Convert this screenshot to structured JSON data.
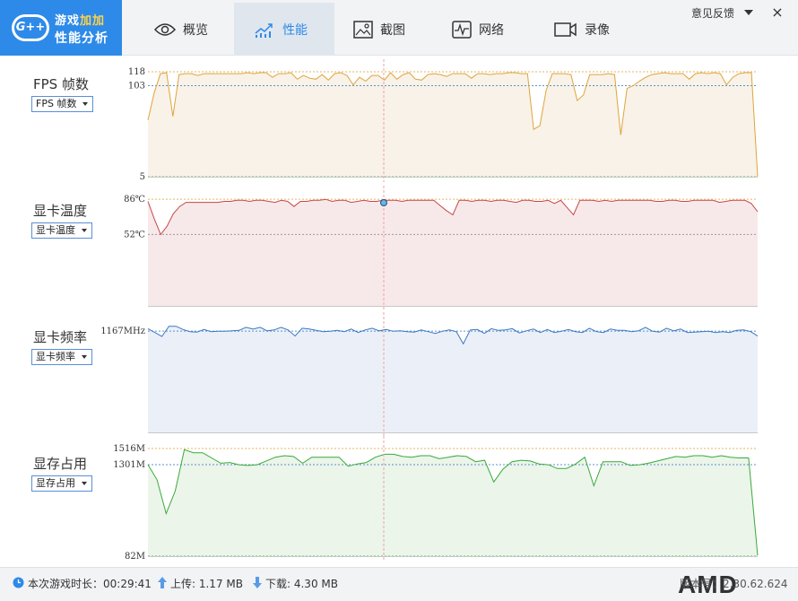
{
  "app": {
    "title_line1_part1": "游戏",
    "title_line1_part2": "加加",
    "title_line2": "性能分析",
    "badge_text": "G++"
  },
  "tabs": [
    {
      "label": "概览",
      "icon": "eye-icon"
    },
    {
      "label": "性能",
      "icon": "line-chart-icon",
      "active": true
    },
    {
      "label": "截图",
      "icon": "image-icon"
    },
    {
      "label": "网络",
      "icon": "pulse-icon"
    },
    {
      "label": "录像",
      "icon": "video-icon"
    }
  ],
  "header": {
    "feedback_label": "意见反馈",
    "close_label": "×"
  },
  "colors": {
    "accent": "#2e8ae8",
    "fps": "#e0a43a",
    "gpu_temp": "#c84646",
    "gpu_clock": "#3a78c0",
    "vram": "#3aa93a"
  },
  "chart_data": [
    {
      "type": "area",
      "title": "FPS 帧数",
      "dropdown": "FPS 帧数",
      "ticks": [
        "118",
        "103",
        "5"
      ],
      "tick_values": [
        118,
        103,
        5
      ],
      "ylim": [
        5,
        118
      ],
      "average": 103,
      "values": [
        66,
        95,
        116,
        117,
        70,
        115,
        116,
        116,
        114,
        116,
        116,
        116,
        116,
        116,
        116,
        116,
        117,
        116,
        117,
        117,
        112,
        116,
        116,
        117,
        110,
        114,
        111,
        110,
        115,
        109,
        116,
        117,
        114,
        104,
        112,
        108,
        114,
        114,
        109,
        117,
        110,
        115,
        117,
        110,
        109,
        115,
        116,
        115,
        113,
        116,
        116,
        116,
        111,
        116,
        116,
        115,
        116,
        116,
        117,
        117,
        116,
        116,
        56,
        60,
        98,
        116,
        116,
        116,
        115,
        87,
        93,
        115,
        115,
        115,
        116,
        115,
        50,
        100,
        103,
        108,
        112,
        115,
        116,
        117,
        116,
        116,
        116,
        110,
        116,
        117,
        116,
        117,
        116,
        104,
        112,
        116,
        117,
        117,
        5
      ]
    },
    {
      "type": "area",
      "title": "显卡温度",
      "dropdown": "显卡温度",
      "ticks": [
        "86℃",
        "52℃"
      ],
      "tick_values": [
        86,
        52
      ],
      "ylim": [
        -17,
        87
      ],
      "values": [
        84,
        67,
        52,
        60,
        72,
        79,
        83,
        83,
        83,
        83,
        83,
        83,
        84,
        84,
        85,
        85,
        84,
        85,
        85,
        84,
        83,
        85,
        84,
        79,
        84,
        84,
        85,
        85,
        86,
        84,
        85,
        85,
        83,
        84,
        85,
        84,
        84,
        85,
        85,
        85,
        84,
        85,
        85,
        85,
        85,
        85,
        80,
        75,
        71,
        85,
        85,
        84,
        85,
        85,
        84,
        85,
        85,
        84,
        83,
        85,
        85,
        84,
        84,
        85,
        82,
        85,
        78,
        71,
        85,
        85,
        85,
        84,
        85,
        84,
        85,
        85,
        85,
        85,
        85,
        85,
        84,
        84,
        85,
        85,
        84,
        84,
        85,
        85,
        85,
        85,
        83,
        84,
        85,
        85,
        85,
        82,
        74
      ]
    },
    {
      "type": "area",
      "title": "显卡频率",
      "dropdown": "显卡频率",
      "ticks": [
        "1167MHz"
      ],
      "tick_values": [
        1167
      ],
      "ylim": [
        0,
        1240
      ],
      "values": [
        1195,
        1150,
        1105,
        1222,
        1222,
        1185,
        1160,
        1155,
        1185,
        1160,
        1165,
        1165,
        1170,
        1175,
        1210,
        1190,
        1210,
        1170,
        1180,
        1210,
        1180,
        1110,
        1200,
        1190,
        1175,
        1160,
        1165,
        1175,
        1160,
        1190,
        1150,
        1180,
        1200,
        1170,
        1185,
        1165,
        1170,
        1160,
        1155,
        1180,
        1160,
        1140,
        1165,
        1180,
        1160,
        1020,
        1180,
        1185,
        1140,
        1195,
        1175,
        1180,
        1195,
        1145,
        1170,
        1190,
        1150,
        1185,
        1150,
        1165,
        1185,
        1160,
        1150,
        1200,
        1160,
        1150,
        1190,
        1175,
        1175,
        1160,
        1170,
        1210,
        1165,
        1155,
        1200,
        1170,
        1190,
        1150,
        1155,
        1160,
        1165,
        1150,
        1160,
        1150,
        1175,
        1180,
        1160,
        1110
      ]
    },
    {
      "type": "area",
      "title": "显存占用",
      "dropdown": "显存占用",
      "ticks": [
        "1516M",
        "1301M",
        "82M"
      ],
      "tick_values": [
        1516,
        1301,
        82
      ],
      "ylim": [
        82,
        1516
      ],
      "average": 1301,
      "values": [
        1301,
        1100,
        650,
        950,
        1500,
        1460,
        1460,
        1390,
        1320,
        1330,
        1300,
        1290,
        1300,
        1350,
        1400,
        1420,
        1410,
        1320,
        1400,
        1400,
        1400,
        1400,
        1280,
        1310,
        1330,
        1400,
        1440,
        1440,
        1410,
        1400,
        1420,
        1420,
        1380,
        1400,
        1420,
        1410,
        1340,
        1360,
        1070,
        1240,
        1340,
        1360,
        1350,
        1310,
        1300,
        1250,
        1250,
        1310,
        1400,
        1020,
        1340,
        1340,
        1340,
        1290,
        1300,
        1320,
        1350,
        1380,
        1410,
        1400,
        1420,
        1420,
        1400,
        1420,
        1400,
        1390,
        1390,
        90
      ]
    }
  ],
  "footer": {
    "session_label": "本次游戏时长：00:29:41",
    "upload_label": "上传: 1.17 MB",
    "download_label": "下载: 4.30 MB",
    "brand": "AMD",
    "version_label": "版本号：2.30.62.624"
  }
}
